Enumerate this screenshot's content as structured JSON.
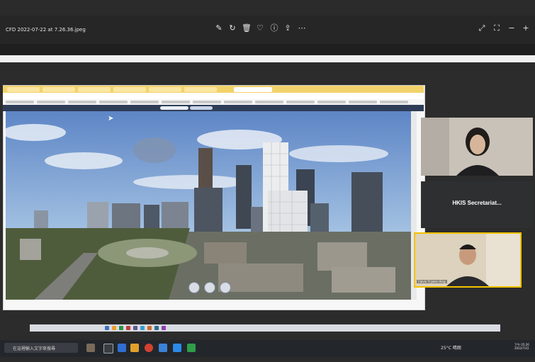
{
  "viewer": {
    "title": "CFD 2022-07-22 at 7.26.36.jpeg",
    "toolbar_icons": [
      "edit-icon",
      "rotate-icon",
      "delete-icon",
      "heart-icon",
      "info-icon",
      "share-icon",
      "more-icon"
    ],
    "window_icons": [
      "expand-icon",
      "fullscreen-icon",
      "zoom-out-icon",
      "zoom-in-icon"
    ]
  },
  "meeting": {
    "tile2_label": "HKIS Secretariat...",
    "tile3_name": "Calvin Yi Jalen Hing"
  },
  "taskbar": {
    "search_placeholder": "在這裡輸入文字來搜尋",
    "temperature": "25°C",
    "weather": "晴朗",
    "clock_line1": "下午 05:26",
    "clock_line2": "2022/7/22"
  },
  "colors": {
    "tab_yellow": "#f2d36b",
    "active_tile_border": "#f2c200",
    "app_header": "#2e3d57"
  }
}
